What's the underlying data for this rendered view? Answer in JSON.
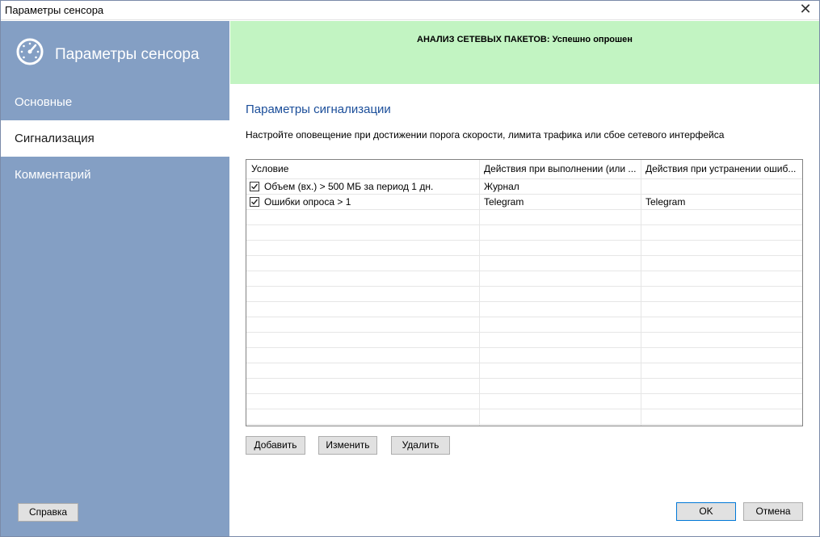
{
  "window": {
    "title": "Параметры сенсора"
  },
  "sidebar": {
    "title": "Параметры сенсора",
    "logo_icon": "gauge-icon",
    "items": [
      {
        "label": "Основные",
        "active": false
      },
      {
        "label": "Сигнализация",
        "active": true
      },
      {
        "label": "Комментарий",
        "active": false
      }
    ],
    "help_label": "Справка"
  },
  "banner": {
    "text": "АНАЛИЗ СЕТЕВЫХ ПАКЕТОВ: Успешно опрошен",
    "color": "#c2f4c2"
  },
  "main": {
    "title": "Параметры сигнализации",
    "description": "Настройте оповещение при достижении порога скорости, лимита трафика или сбое сетевого интерфейса",
    "table": {
      "headers": [
        "Условие",
        "Действия при выполнении (или ...",
        "Действия при устранении ошиб..."
      ],
      "rows": [
        {
          "checked": true,
          "condition": "Объем (вх.)  > 500 МБ за период 1 дн.",
          "on_trigger": "Журнал",
          "on_clear": ""
        },
        {
          "checked": true,
          "condition": "Ошибки опроса > 1",
          "on_trigger": "Telegram",
          "on_clear": "Telegram"
        }
      ]
    },
    "buttons": {
      "add": "Добавить",
      "edit": "Изменить",
      "delete": "Удалить"
    }
  },
  "footer": {
    "ok": "OK",
    "cancel": "Отмена"
  }
}
